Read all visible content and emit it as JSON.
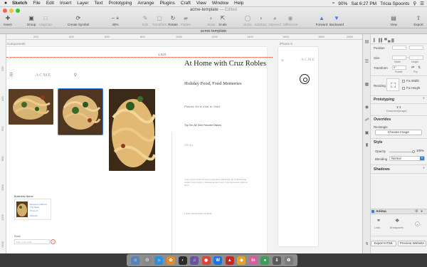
{
  "menubar": {
    "apple": "",
    "items": [
      "Sketch",
      "File",
      "Edit",
      "Insert",
      "Layer",
      "Text",
      "Prototyping",
      "Arrange",
      "Plugins",
      "Craft",
      "View",
      "Window",
      "Help"
    ],
    "battery": "90%",
    "clock": "Sat 6:27 PM",
    "user": "Tricia Spoonts"
  },
  "window": {
    "title": "acme-template",
    "status": "— Edited",
    "tab": "acme-template"
  },
  "toolbar": {
    "insert": "Insert",
    "group": "Group",
    "ungroup": "Ungroup",
    "create_symbol": "Create Symbol",
    "zoom": "48%",
    "edit": "Edit",
    "transform": "Transform",
    "rotate": "Rotate",
    "flatten": "Flatten",
    "mask": "Mask",
    "scale": "Scale",
    "union": "Union",
    "subtract": "Subtract",
    "intersect": "Intersect",
    "difference": "Difference",
    "forward": "Forward",
    "backward": "Backward",
    "view": "View",
    "export": "Export"
  },
  "rulers": {
    "h": [
      "200",
      "400",
      "600",
      "800",
      "1000",
      "1200",
      "1400",
      "1600",
      "1800",
      "2000"
    ],
    "v": [
      "200",
      "400",
      "600",
      "800",
      "1000",
      "1200",
      "1400"
    ]
  },
  "canvas": {
    "main_artboard_label": "Components",
    "iphone_artboard_label": "iPhone 8",
    "width_marker": "1,520",
    "brand": "ACME",
    "hero_title": "At Home with Cruz Robles",
    "hero_subtitle": "Holiday Food, Food Memories",
    "places": "Places He'd Like to Visit",
    "top_ten": "Top Ten All Time Favorite Dishes",
    "see_all": "SEE ALL",
    "lorem": "Lorem ipsum dolor sit amet consectetur adipiscing elit. Pellentesque pretium lorem purus a consequat nec lorem. Cras fermentum tellus ut amet.",
    "more_link": "Lorem ipsum dolor sit amet",
    "business_title": "Business Name",
    "business_lines": [
      "Business Address City State",
      "Phone #",
      "Website"
    ],
    "newsletter_label": "Email",
    "newsletter_placeholder": "Enter your email"
  },
  "inspector": {
    "position": "Position",
    "size": "Size",
    "width": "Width",
    "height": "Height",
    "transform": "Transform",
    "rotate_value": "0°",
    "rotate": "Rotate",
    "flip": "Flip",
    "resizing": "Resizing",
    "fix_width": "Fix Width",
    "fix_height": "Fix Height",
    "prototyping": "Prototyping",
    "ratio": "1:1",
    "ratio_sub": "Document(image)",
    "overrides": "Overrides",
    "rectangle": "Rectangle",
    "choose_image": "Choose Image",
    "style": "Style",
    "opacity": "Opacity",
    "opacity_value": "100%",
    "opacity_level": 100,
    "blending": "Blending",
    "blending_value": "Normal",
    "shadows": "Shadows",
    "anima": "Anima",
    "links": "Links",
    "breakpoints": "Breakpoints",
    "export_html": "Export HTML",
    "preview_website": "Preview Website"
  },
  "colors": {
    "accent": "#3b7ddd",
    "guide": "#e74c3c"
  }
}
